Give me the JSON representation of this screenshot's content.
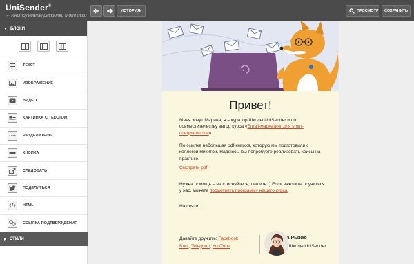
{
  "app": {
    "logo_name": "UniSender",
    "logo_tagline": "← Инструменты рассылки и отписки"
  },
  "toolbar": {
    "history_label": "ИСТОРИЯ",
    "preview_label": "ПРОСМОТР",
    "save_label": "СОХРАНИТЬ"
  },
  "sidebar": {
    "blocks_header": "БЛОКИ",
    "styles_header": "СТИЛИ",
    "items": [
      {
        "label": "ТЕКСТ",
        "icon": "text-icon"
      },
      {
        "label": "ИЗОБРАЖЕНИЕ",
        "icon": "image-icon"
      },
      {
        "label": "ВИДЕО",
        "icon": "video-icon"
      },
      {
        "label": "КАРТИНКА С ТЕКСТОМ",
        "icon": "image-text-icon"
      },
      {
        "label": "РАЗДЕЛИТЕЛЬ",
        "icon": "divider-icon"
      },
      {
        "label": "КНОПКА",
        "icon": "button-icon"
      },
      {
        "label": "СЛЕДОВАТЬ",
        "icon": "follow-icon"
      },
      {
        "label": "ПОДЕЛИТЬСЯ",
        "icon": "twitter-icon"
      },
      {
        "label": "HTML",
        "icon": "code-icon"
      },
      {
        "label": "ССЫЛКА ПОДТВЕРЖДЕНИЯ",
        "icon": "link-icon"
      }
    ]
  },
  "email": {
    "greeting": "Привет!",
    "p1_a": "Меня зовут Марина, я – куратор Школы UniSender и по совместительству автор курса «",
    "p1_link": "Email-маркетинг для smm-специалистов",
    "p1_b": "».",
    "p2": "По ссылке небольшая pdf-книжка, которую мы подготовили с коллегой Никитой. Надеюсь, вы попробуете реализовать кейсы на практике.",
    "p3_link": "Смотреть pdf",
    "p4_a": "Нужна помощь – не стесняйтесь, пишите :) Если захотите поучиться у нас, можете ",
    "p4_link": "посмотреть программу нашего курса",
    "p4_b": ".",
    "p5": "На связи!",
    "footer_prefix": "Давайте дружить: ",
    "footer_links": [
      "Facebook",
      "Блог",
      "Telegram",
      "YouTube"
    ],
    "signature_name": "Марина Рыжко",
    "signature_role": "куратор Школы UniSender"
  },
  "colors": {
    "topbar": "#4b4b4b",
    "email_bg": "#fbf7df",
    "link": "#c94b2a",
    "hero_bg": "#e2e7f2",
    "laptop": "#7a4f86",
    "fox": "#f0a033"
  }
}
